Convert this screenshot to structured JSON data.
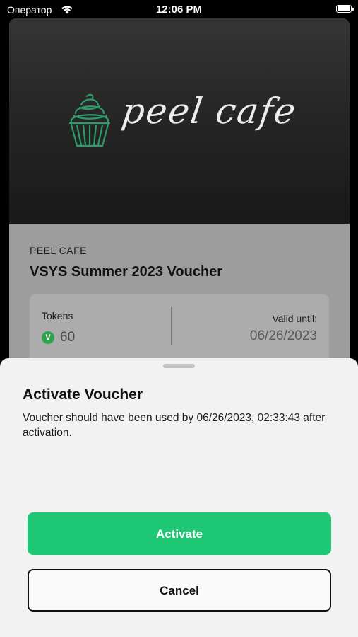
{
  "status_bar": {
    "carrier": "Оператор",
    "time": "12:06 PM",
    "wifi_icon": "wifi-icon",
    "battery_icon": "battery-icon"
  },
  "voucher": {
    "logo_text": "peel cafe",
    "logo_icon": "cupcake-icon",
    "merchant": "PEEL CAFE",
    "title": "VSYS Summer 2023 Voucher",
    "tokens_label": "Tokens",
    "token_icon_glyph": "V",
    "token_icon": "vsys-token-icon",
    "tokens_value": "60",
    "valid_label": "Valid until:",
    "valid_value": "06/26/2023",
    "colors": {
      "logo_accent": "#2e9b6a",
      "token_icon": "#2ea44f"
    }
  },
  "sheet": {
    "title": "Activate Voucher",
    "message": "Voucher should have been used by 06/26/2023, 02:33:43 after activation.",
    "activate_label": "Activate",
    "cancel_label": "Cancel",
    "colors": {
      "activate_bg": "#1ec774",
      "activate_text": "#ffffff",
      "cancel_border": "#111111"
    }
  }
}
